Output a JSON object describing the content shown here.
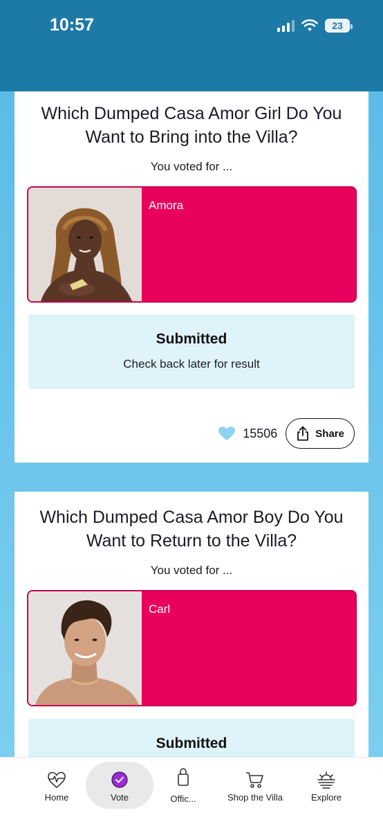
{
  "status_bar": {
    "time": "10:57",
    "battery": "23"
  },
  "cards": [
    {
      "title": "Which Dumped Casa Amor Girl Do You Want to Bring into the Villa?",
      "voted_for_label": "You voted for ...",
      "choice_name": "Amora",
      "submitted_title": "Submitted",
      "submitted_sub": "Check back later for result",
      "likes": "15506",
      "share_label": "Share"
    },
    {
      "title": "Which Dumped Casa Amor Boy Do You Want to Return to the Villa?",
      "voted_for_label": "You voted for ...",
      "choice_name": "Carl",
      "submitted_title": "Submitted"
    }
  ],
  "nav": {
    "items": [
      {
        "label": "Home",
        "icon": "heartbeat-icon"
      },
      {
        "label": "Vote",
        "icon": "checkmark-circle-icon",
        "active": true
      },
      {
        "label": "Offic...",
        "icon": "shopping-bag-icon"
      },
      {
        "label": "Shop the Villa",
        "icon": "shopping-cart-icon"
      },
      {
        "label": "Explore",
        "icon": "sunset-icon"
      }
    ]
  },
  "colors": {
    "header": "#1d7aa6",
    "background": "#6cc6ee",
    "choice_card": "#e8005c",
    "submitted_bg": "#dff3fb",
    "heart": "#8fd3f1",
    "vote_active": "#9b2bd9"
  }
}
